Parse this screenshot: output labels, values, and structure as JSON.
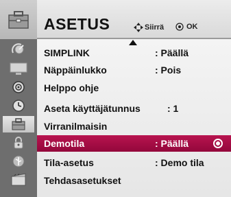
{
  "header": {
    "title": "ASETUS",
    "hint_move": "Siirrä",
    "hint_ok": "OK"
  },
  "sidebar": {
    "items": [
      {
        "icon": "satellite-dish-icon",
        "active": false
      },
      {
        "icon": "tv-screen-icon",
        "active": false
      },
      {
        "icon": "speaker-icon",
        "active": false
      },
      {
        "icon": "clock-icon",
        "active": false
      },
      {
        "icon": "toolbox-icon",
        "active": true
      },
      {
        "icon": "lock-icon",
        "active": false
      },
      {
        "icon": "usb-icon",
        "active": false
      },
      {
        "icon": "film-icon",
        "active": false
      }
    ]
  },
  "menu": {
    "items": [
      {
        "label": "SIMPLINK",
        "value": ": Päällä"
      },
      {
        "label": "Näppäinlukko",
        "value": ": Pois"
      },
      {
        "label": "Helppo ohje",
        "value": ""
      },
      {
        "label": "Aseta käyttäjätunnus",
        "value": ": 1"
      },
      {
        "label": "Virranilmaisin",
        "value": ""
      },
      {
        "label": "Demotila",
        "value": ": Päällä",
        "selected": true
      },
      {
        "label": "Tila-asetus",
        "value": ": Demo tila"
      },
      {
        "label": "Tehdasasetukset",
        "value": ""
      }
    ]
  },
  "colors": {
    "selection": "#a80d47",
    "sidebar": "#6e6e6e",
    "content": "#eeeeee"
  }
}
